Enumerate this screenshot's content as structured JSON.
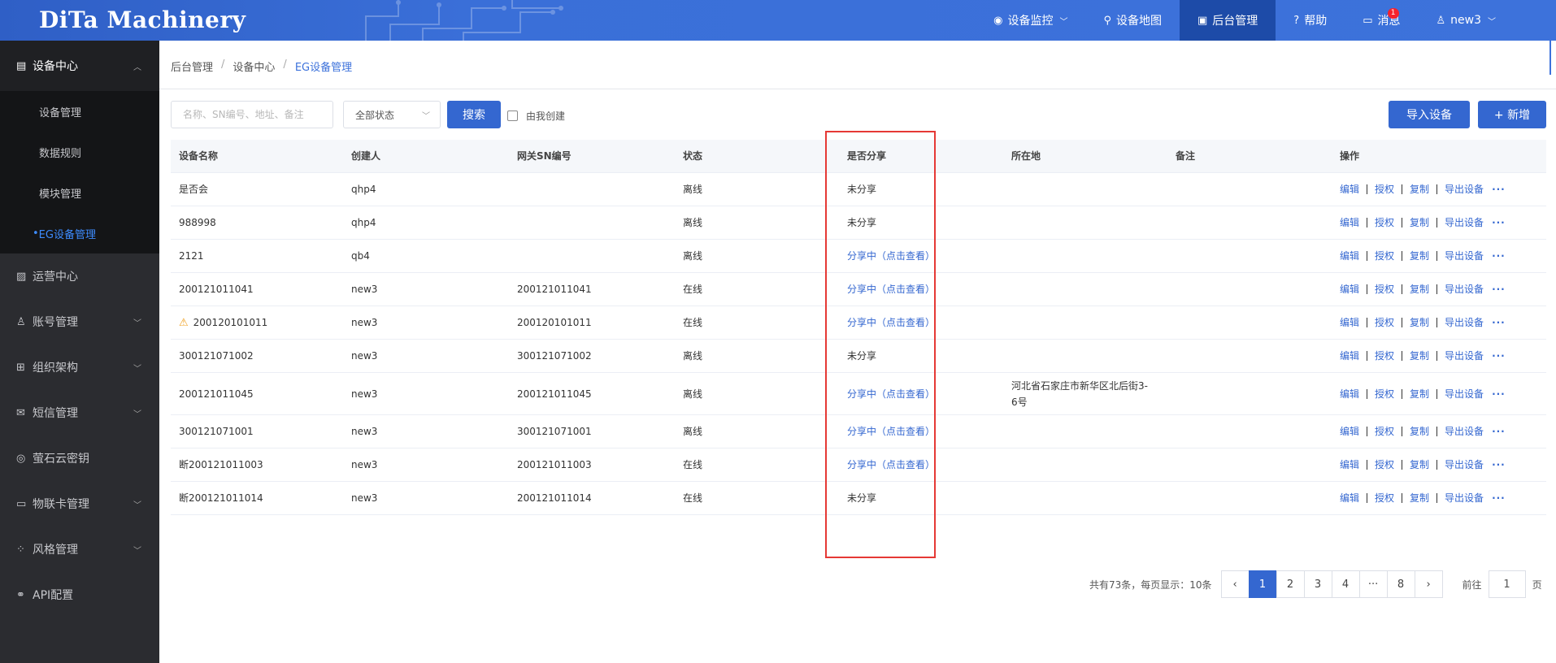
{
  "header": {
    "logo": "DiTa Machinery",
    "nav": [
      {
        "label": "设备监控",
        "icon": "location-pin-icon",
        "dropdown": true
      },
      {
        "label": "设备地图",
        "icon": "user-pin-icon",
        "dropdown": false
      },
      {
        "label": "后台管理",
        "icon": "monitor-icon",
        "dropdown": false,
        "active": true
      },
      {
        "label": "帮助",
        "icon": "help-circle-icon",
        "dropdown": false
      },
      {
        "label": "消息",
        "icon": "message-icon",
        "dropdown": false,
        "badge": "1"
      },
      {
        "label": "new3",
        "icon": "user-icon",
        "dropdown": true
      }
    ]
  },
  "sidebar": {
    "group": {
      "label": "设备中心",
      "icon": "server-icon"
    },
    "sub_items": [
      "设备管理",
      "数据规则",
      "模块管理",
      "EG设备管理"
    ],
    "items": [
      {
        "label": "运营中心",
        "icon": "chart-icon",
        "arrow": false
      },
      {
        "label": "账号管理",
        "icon": "user-icon",
        "arrow": true
      },
      {
        "label": "组织架构",
        "icon": "org-icon",
        "arrow": true
      },
      {
        "label": "短信管理",
        "icon": "mail-icon",
        "arrow": true
      },
      {
        "label": "萤石云密钥",
        "icon": "key-circle-icon",
        "arrow": false
      },
      {
        "label": "物联卡管理",
        "icon": "card-icon",
        "arrow": true
      },
      {
        "label": "风格管理",
        "icon": "grid-icon",
        "arrow": true
      },
      {
        "label": "API配置",
        "icon": "link-icon",
        "arrow": false
      }
    ]
  },
  "breadcrumb": [
    "后台管理",
    "设备中心",
    "EG设备管理"
  ],
  "toolbar": {
    "search_placeholder": "名称、SN编号、地址、备注",
    "status_select": "全部状态",
    "search_button": "搜索",
    "created_by_me": "由我创建",
    "import_button": "导入设备",
    "add_button": "+ 新增"
  },
  "table": {
    "headers": [
      "设备名称",
      "创建人",
      "网关SN编号",
      "状态",
      "是否分享",
      "所在地",
      "备注",
      "操作"
    ],
    "ops": [
      "编辑",
      "授权",
      "复制",
      "导出设备"
    ],
    "rows": [
      {
        "name": "是否会",
        "creator": "qhp4",
        "sn": "",
        "status": "离线",
        "share": "未分享",
        "shared": false,
        "location": "",
        "note": "",
        "warn": false
      },
      {
        "name": "988998",
        "creator": "qhp4",
        "sn": "",
        "status": "离线",
        "share": "未分享",
        "shared": false,
        "location": "",
        "note": "",
        "warn": false
      },
      {
        "name": "2121",
        "creator": "qb4",
        "sn": "",
        "status": "离线",
        "share": "分享中（点击查看）",
        "shared": true,
        "location": "",
        "note": "",
        "warn": false
      },
      {
        "name": "200121011041",
        "creator": "new3",
        "sn": "200121011041",
        "status": "在线",
        "share": "分享中（点击查看）",
        "shared": true,
        "location": "",
        "note": "",
        "warn": false
      },
      {
        "name": "200120101011",
        "creator": "new3",
        "sn": "200120101011",
        "status": "在线",
        "share": "分享中（点击查看）",
        "shared": true,
        "location": "",
        "note": "",
        "warn": true
      },
      {
        "name": "300121071002",
        "creator": "new3",
        "sn": "300121071002",
        "status": "离线",
        "share": "未分享",
        "shared": false,
        "location": "",
        "note": "",
        "warn": false
      },
      {
        "name": "200121011045",
        "creator": "new3",
        "sn": "200121011045",
        "status": "离线",
        "share": "分享中（点击查看）",
        "shared": true,
        "location": "河北省石家庄市新华区北后街3-6号",
        "note": "",
        "warn": false
      },
      {
        "name": "300121071001",
        "creator": "new3",
        "sn": "300121071001",
        "status": "离线",
        "share": "分享中（点击查看）",
        "shared": true,
        "location": "",
        "note": "",
        "warn": false
      },
      {
        "name": "断200121011003",
        "creator": "new3",
        "sn": "200121011003",
        "status": "在线",
        "share": "分享中（点击查看）",
        "shared": true,
        "location": "",
        "note": "",
        "warn": false
      },
      {
        "name": "断200121011014",
        "creator": "new3",
        "sn": "200121011014",
        "status": "在线",
        "share": "未分享",
        "shared": false,
        "location": "",
        "note": "",
        "warn": false
      }
    ]
  },
  "pagination": {
    "total_text": "共有73条，每页显示：10条",
    "pages": [
      "1",
      "2",
      "3",
      "4",
      "···",
      "8"
    ],
    "current": "1",
    "goto_label": "前往",
    "goto_value": "1",
    "goto_suffix": "页"
  },
  "colors": {
    "primary": "#3467d0",
    "header": "#3d72db",
    "sidebar": "#2b2c30",
    "highlight_box": "#e53935"
  }
}
